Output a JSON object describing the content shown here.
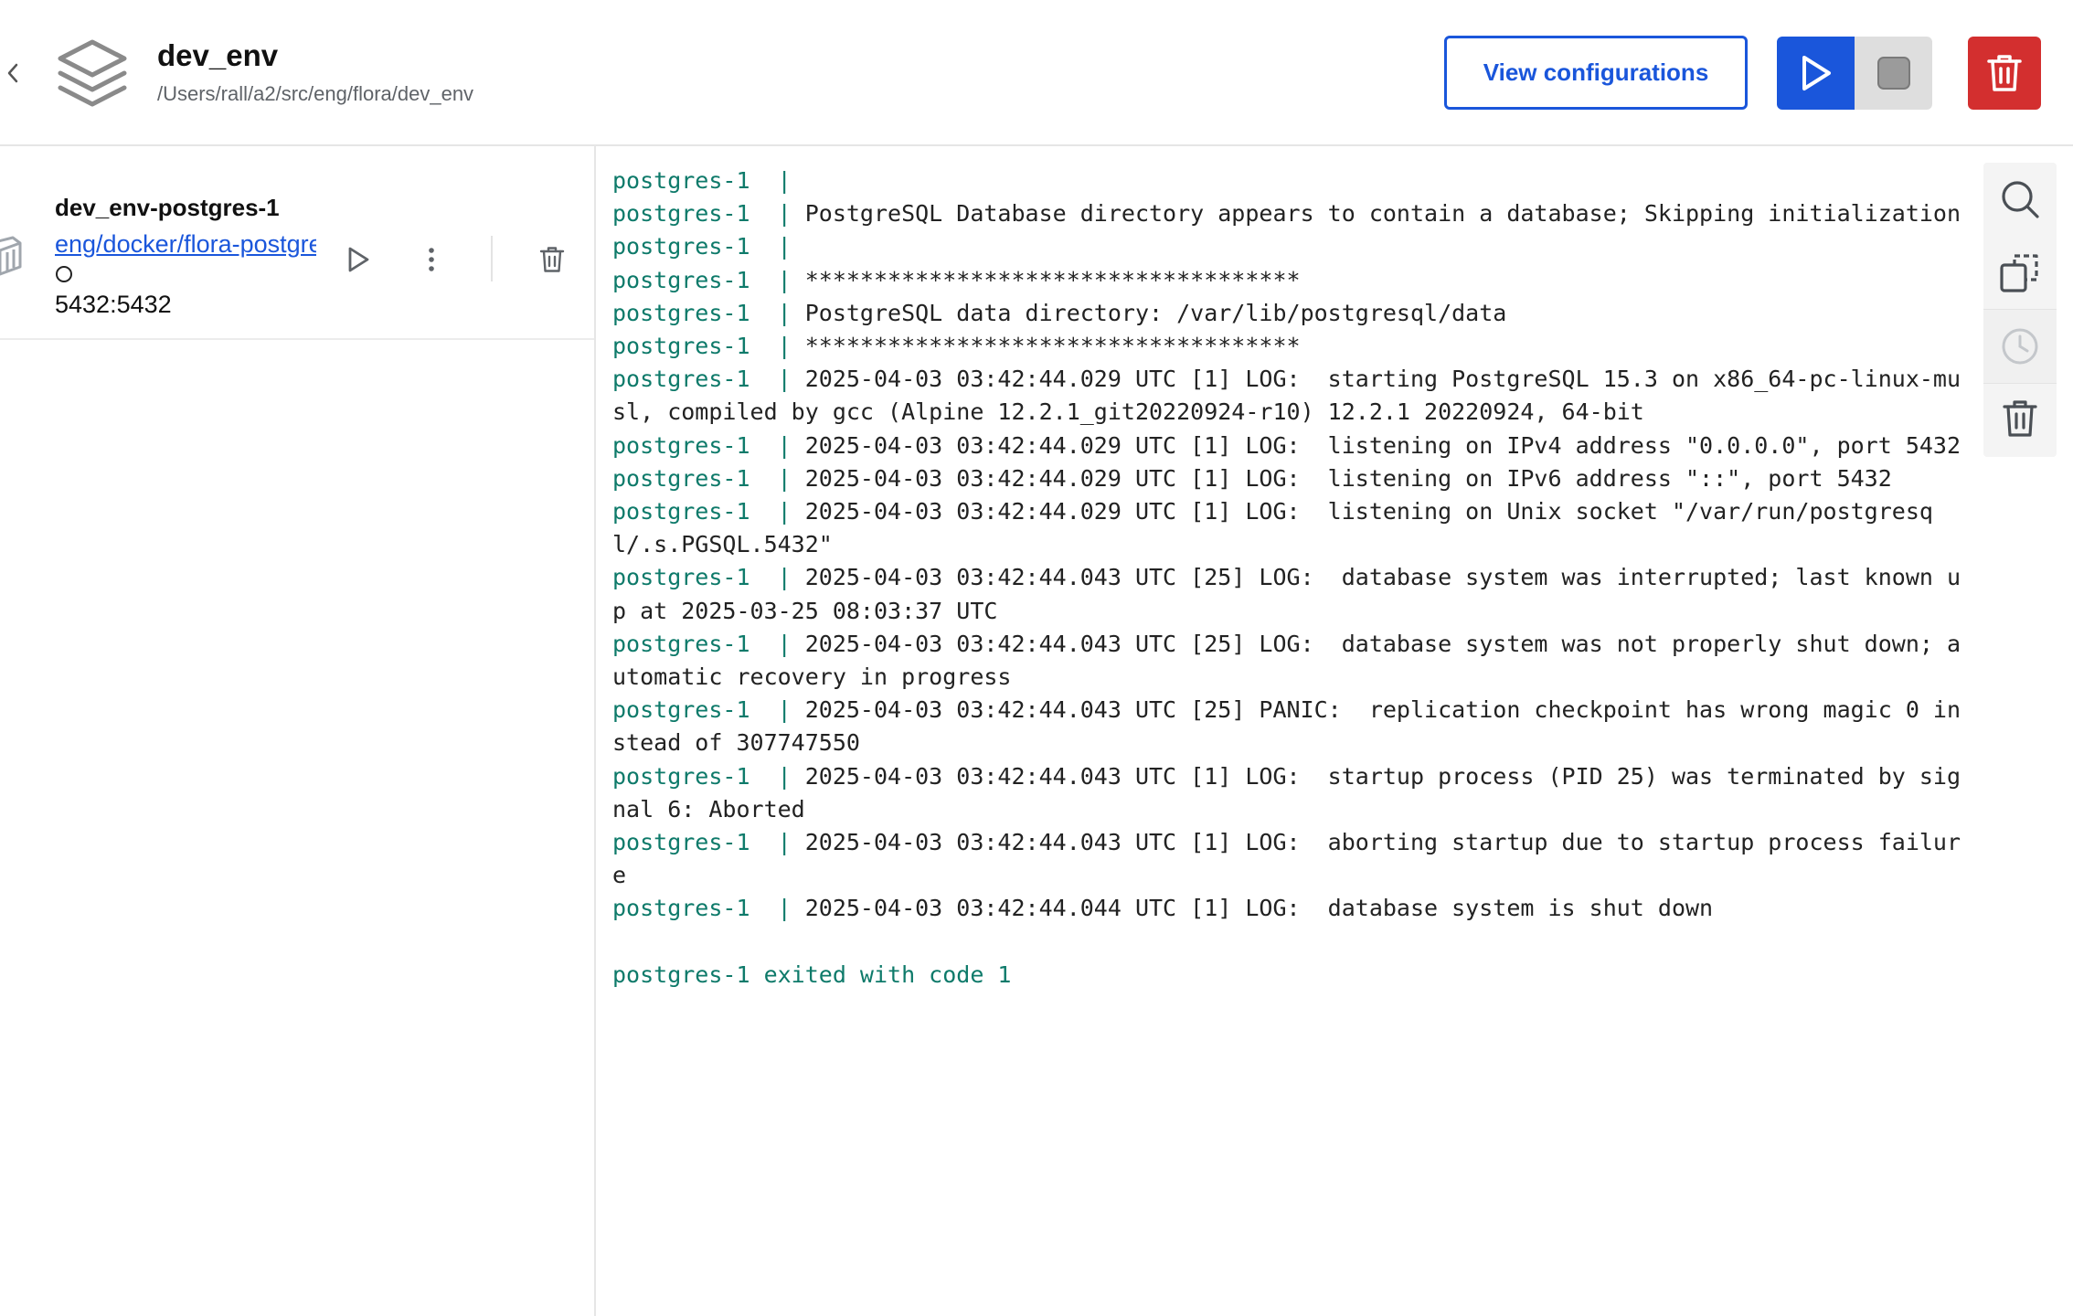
{
  "header": {
    "title": "dev_env",
    "path": "/Users/rall/a2/src/eng/flora/dev_env",
    "view_config_label": "View configurations",
    "icons": {
      "back": "chevron-left-icon",
      "project": "layers-icon",
      "play": "play-icon",
      "stop": "stop-icon",
      "delete": "trash-icon"
    },
    "colors": {
      "primary": "#1a56db",
      "danger": "#d32f2f",
      "stop_bg": "#dedede"
    }
  },
  "containers": [
    {
      "name": "dev_env-postgres-1",
      "image_link": "eng/docker/flora-postgres",
      "status": "stopped",
      "ports": "5432:5432"
    }
  ],
  "log": {
    "prefix": "postgres-1  | ",
    "lines": [
      "",
      "PostgreSQL Database directory appears to contain a database; Skipping initialization",
      "",
      "************************************",
      "PostgreSQL data directory: /var/lib/postgresql/data",
      "************************************",
      "2025-04-03 03:42:44.029 UTC [1] LOG:  starting PostgreSQL 15.3 on x86_64-pc-linux-musl, compiled by gcc (Alpine 12.2.1_git20220924-r10) 12.2.1 20220924, 64-bit",
      "2025-04-03 03:42:44.029 UTC [1] LOG:  listening on IPv4 address \"0.0.0.0\", port 5432",
      "2025-04-03 03:42:44.029 UTC [1] LOG:  listening on IPv6 address \"::\", port 5432",
      "2025-04-03 03:42:44.029 UTC [1] LOG:  listening on Unix socket \"/var/run/postgresql/.s.PGSQL.5432\"",
      "2025-04-03 03:42:44.043 UTC [25] LOG:  database system was interrupted; last known up at 2025-03-25 08:03:37 UTC",
      "2025-04-03 03:42:44.043 UTC [25] LOG:  database system was not properly shut down; automatic recovery in progress",
      "2025-04-03 03:42:44.043 UTC [25] PANIC:  replication checkpoint has wrong magic 0 instead of 307747550",
      "2025-04-03 03:42:44.043 UTC [1] LOG:  startup process (PID 25) was terminated by signal 6: Aborted",
      "2025-04-03 03:42:44.043 UTC [1] LOG:  aborting startup due to startup process failure",
      "2025-04-03 03:42:44.044 UTC [1] LOG:  database system is shut down"
    ],
    "exit_message": "postgres-1 exited with code 1",
    "colors": {
      "prefix": "#0e7a6a",
      "text": "#222222"
    }
  },
  "log_toolbar": {
    "items": [
      {
        "icon": "search-icon",
        "enabled": true
      },
      {
        "icon": "copy-icon",
        "enabled": true
      },
      {
        "icon": "clock-icon",
        "enabled": false
      },
      {
        "icon": "trash-icon",
        "enabled": true
      }
    ]
  }
}
